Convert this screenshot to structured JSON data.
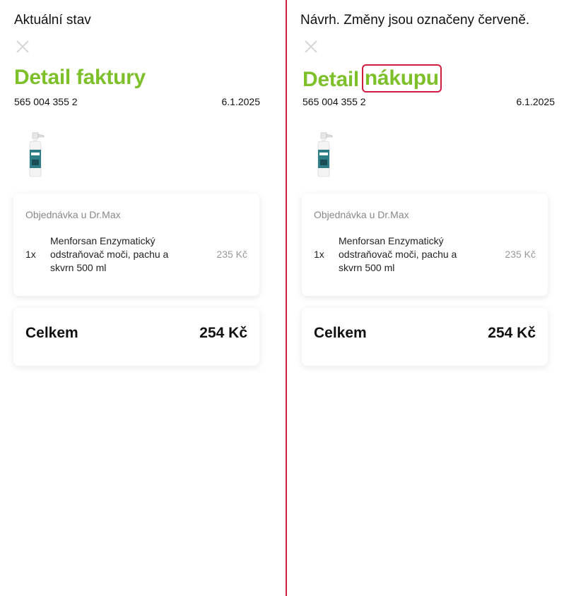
{
  "colors": {
    "brand_green": "#7dc02a",
    "change_red": "#cf1d3f",
    "muted_gray": "#888888"
  },
  "left": {
    "header": "Aktuální stav",
    "close_icon": "close-icon",
    "title": "Detail faktury",
    "order_number": "565 004 355 2",
    "date": "6.1.2025",
    "order_card": {
      "subtitle": "Objednávka u Dr.Max",
      "item": {
        "qty": "1x",
        "name": "Menforsan Enzymatický odstraňovač moči, pachu a skvrn 500 ml",
        "price": "235 Kč"
      }
    },
    "total": {
      "label": "Celkem",
      "value": "254 Kč"
    }
  },
  "right": {
    "header": "Návrh. Změny jsou označeny červeně.",
    "close_icon": "close-icon",
    "title_prefix": "Detail",
    "title_changed": "nákupu",
    "order_number": "565 004 355 2",
    "date": "6.1.2025",
    "order_card": {
      "subtitle": "Objednávka u Dr.Max",
      "item": {
        "qty": "1x",
        "name": "Menforsan Enzymatický odstraňovač moči, pachu a skvrn 500 ml",
        "price": "235 Kč"
      }
    },
    "total": {
      "label": "Celkem",
      "value": "254 Kč"
    }
  }
}
